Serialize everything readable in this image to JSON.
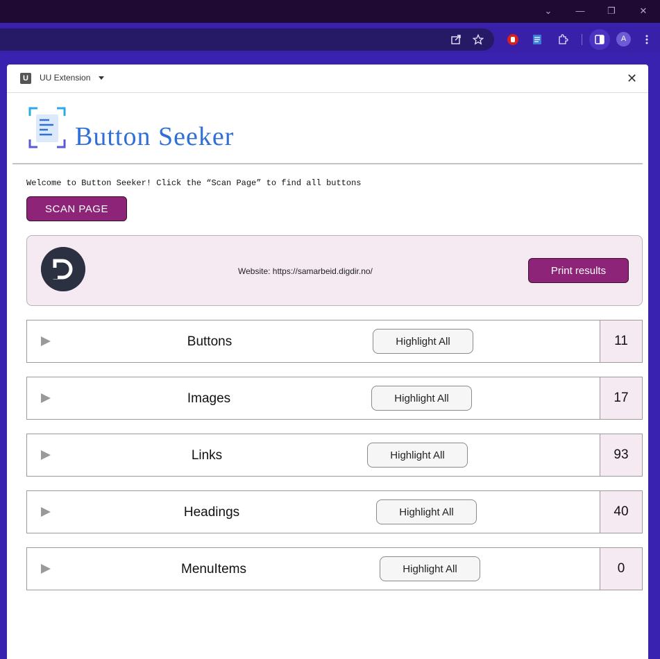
{
  "browser": {
    "avatar_letter": "A",
    "window_controls": {
      "dropdown": "⌄",
      "minimize": "—",
      "restore": "❐",
      "close": "✕"
    }
  },
  "panel": {
    "extension_name": "UU Extension",
    "extension_icon_letter": "U",
    "close_label": "✕"
  },
  "app": {
    "title": "Button Seeker",
    "welcome": "Welcome to Button Seeker! Click the “Scan Page” to find all buttons",
    "scan_label": "SCAN PAGE",
    "accent_color": "#8e2478",
    "title_color": "#2f6fd6"
  },
  "site": {
    "label": "Website: https://samarbeid.digdir.no/",
    "print_label": "Print results"
  },
  "categories": [
    {
      "name": "Buttons",
      "highlight_label": "Highlight All",
      "count": "11"
    },
    {
      "name": "Images",
      "highlight_label": "Highlight All",
      "count": "17"
    },
    {
      "name": "Links",
      "highlight_label": "Highlight All",
      "count": "93"
    },
    {
      "name": "Headings",
      "highlight_label": "Highlight All",
      "count": "40"
    },
    {
      "name": "MenuItems",
      "highlight_label": "Highlight All",
      "count": "0"
    }
  ]
}
